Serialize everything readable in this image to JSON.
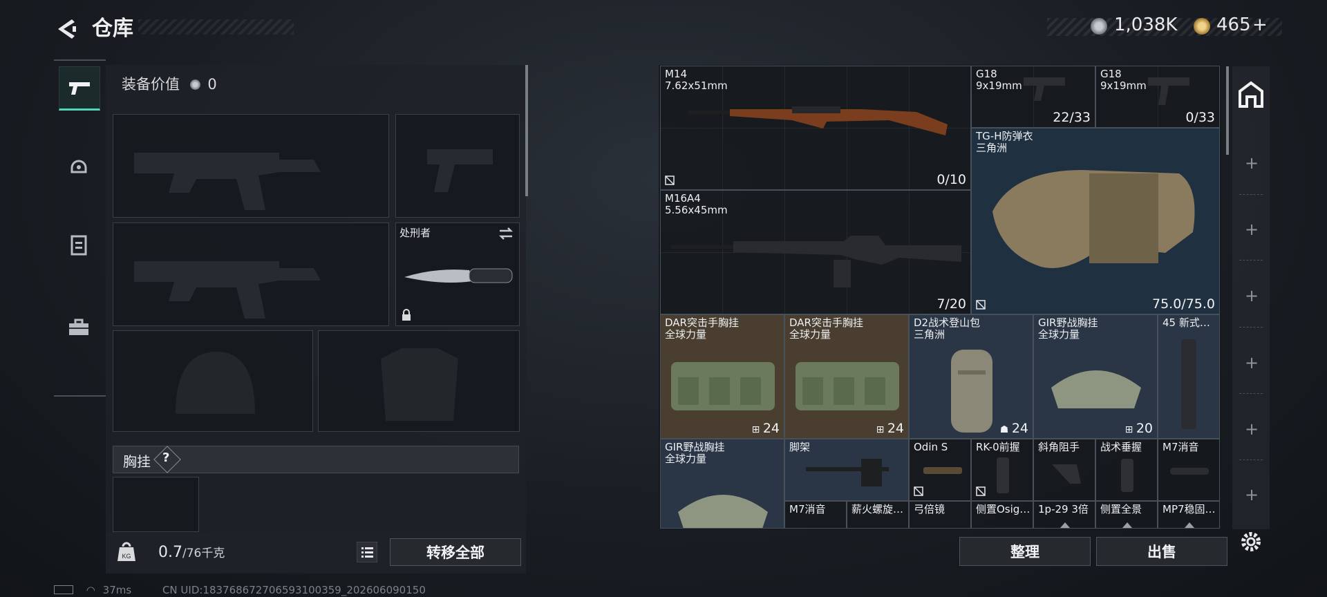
{
  "header": {
    "title": "仓库",
    "currency1": "1,038K",
    "currency2": "465",
    "currency2_plus": "+",
    "gold": "#c7a25a"
  },
  "loadout": {
    "value_label": "装备价值",
    "value": "0",
    "melee_name": "处刑者",
    "chest_section": "胸挂",
    "help": "?",
    "weight_value": "0.7",
    "weight_total": "/76千克",
    "transfer_all": "转移全部"
  },
  "inventory": {
    "items": [
      {
        "name": "M14\n7.62x51mm",
        "count": "0/10"
      },
      {
        "name": "G18\n9x19mm",
        "count": "22/33"
      },
      {
        "name": "G18\n9x19mm",
        "count": "0/33"
      },
      {
        "name": "TG-H防弹衣\n三角洲",
        "count": "75.0/75.0"
      },
      {
        "name": "M16A4\n5.56x45mm",
        "count": "7/20"
      },
      {
        "name": "DAR突击手胸挂\n全球力量",
        "count": "24"
      },
      {
        "name": "DAR突击手胸挂\n全球力量",
        "count": "24"
      },
      {
        "name": "D2战术登山包\n三角洲",
        "count": "24"
      },
      {
        "name": "GIR野战胸挂\n全球力量",
        "count": "20"
      },
      {
        "name": "45 新式…",
        "count": ""
      },
      {
        "name": "GIR野战胸挂\n全球力量",
        "count": ""
      },
      {
        "name": "脚架",
        "count": ""
      },
      {
        "name": "Odin S",
        "count": ""
      },
      {
        "name": "RK-0前握",
        "count": ""
      },
      {
        "name": "斜角阻手",
        "count": ""
      },
      {
        "name": "战术垂握",
        "count": ""
      },
      {
        "name": "M7消音",
        "count": ""
      },
      {
        "name": "M7消音",
        "count": ""
      },
      {
        "name": "薪火螺旋…",
        "count": ""
      },
      {
        "name": "弓倍镜",
        "count": ""
      },
      {
        "name": "侧置Osig…",
        "count": ""
      },
      {
        "name": "1p-29 3倍",
        "count": ""
      },
      {
        "name": "侧置全景",
        "count": ""
      },
      {
        "name": "MP7稳固…",
        "count": ""
      }
    ],
    "sort_button": "整理",
    "sell_button": "出售"
  },
  "footer": {
    "ping": "37ms",
    "uid": "CN UID:18376867270659310035​9_202606090150"
  }
}
